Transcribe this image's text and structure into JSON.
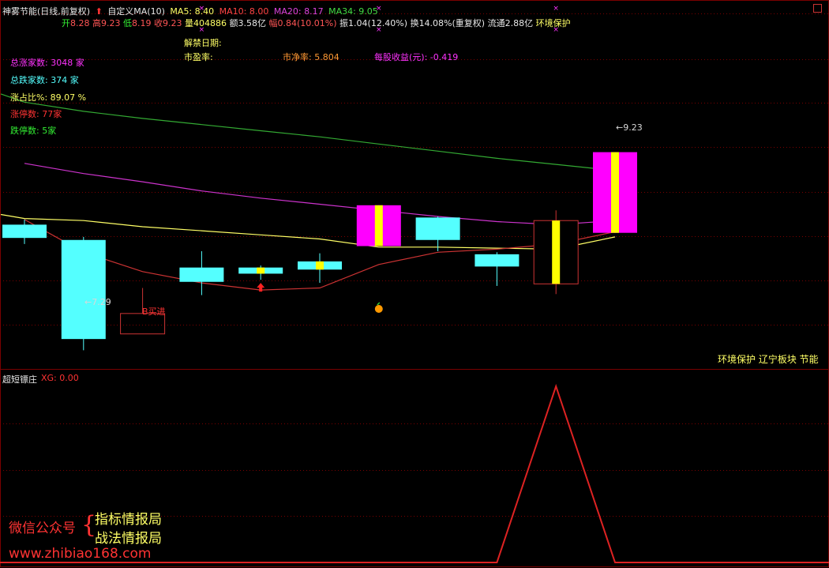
{
  "header": {
    "stock_title": "神雾节能(日线,前复权)",
    "indicator_name": "自定义MA(10)",
    "ma5": "MA5: 8.40",
    "ma10": "MA10: 8.00",
    "ma20": "MA20: 8.17",
    "ma34": "MA34: 9.05"
  },
  "quote_line": {
    "open_label": "开",
    "open": "8.28",
    "high_label": "高",
    "high": "9.23",
    "low_label": "低",
    "low": "8.19",
    "close_label": "收",
    "close": "9.23",
    "volume_label": "量",
    "volume": "404886",
    "amount_label": "额",
    "amount": "3.58亿",
    "change_label": "幅",
    "change": "0.84(10.01%)",
    "amplitude_label": "振",
    "amplitude": "1.04(12.40%)",
    "turnover_label": "换",
    "turnover": "14.08%(重复权)",
    "float_label": "流通",
    "float": "2.88亿",
    "concept": "环境保护"
  },
  "info": {
    "unlock_date_label": "解禁日期:",
    "pe_label": "市盈率:",
    "pb_text": "市净率: 5.804",
    "eps_text": "每股收益(元): -0.419"
  },
  "market_stats": {
    "up_count": "总涨家数: 3048 家",
    "down_count": "总跌家数: 374 家",
    "up_ratio": "涨占比%: 89.07 %",
    "limit_up": "涨停数: 77家",
    "limit_down": "跌停数: 5家"
  },
  "annotations": {
    "low_marker": "←7.29",
    "high_marker": "←9.23",
    "buy_signal": "B买进",
    "sector_tags": "环境保护 辽宁板块 节能"
  },
  "sub_panel": {
    "title": "超短镖庄",
    "xg_label": "XG: 0.00"
  },
  "watermark": {
    "wechat_label": "微信公众号",
    "brace": "{",
    "account1": "指标情报局",
    "account2": "战法情报局",
    "url": "www.zhibiao168.com"
  },
  "colors": {
    "up_fill": "#ff00ff",
    "up_body_inner": "#ffff00",
    "down_fill": "#54ffff",
    "up_hollow": "#cc3333",
    "ma5": "#ffff66",
    "ma10": "#cc3333",
    "ma20": "#cc33cc",
    "ma34": "#33aa33",
    "grid": "#7a0000",
    "xg_line": "#dd2222"
  },
  "chart_data": {
    "type": "candlestick",
    "price_range": [
      7.2,
      9.9
    ],
    "candles": [
      {
        "open": 8.52,
        "high": 8.57,
        "low": 8.33,
        "close": 8.39,
        "style": "down"
      },
      {
        "open": 8.37,
        "high": 8.4,
        "low": 7.29,
        "close": 7.4,
        "style": "down"
      },
      {
        "open": 7.65,
        "high": 7.9,
        "low": 7.45,
        "close": 7.45,
        "style": "buy_box"
      },
      {
        "open": 8.1,
        "high": 8.26,
        "low": 7.83,
        "close": 7.96,
        "style": "down"
      },
      {
        "open": 8.04,
        "high": 8.12,
        "low": 7.98,
        "close": 8.1,
        "style": "down_core"
      },
      {
        "open": 8.16,
        "high": 8.24,
        "low": 7.95,
        "close": 8.08,
        "style": "down_core"
      },
      {
        "open": 8.31,
        "high": 8.71,
        "low": 8.31,
        "close": 8.71,
        "style": "up"
      },
      {
        "open": 8.59,
        "high": 8.6,
        "low": 8.26,
        "close": 8.37,
        "style": "down"
      },
      {
        "open": 8.23,
        "high": 8.25,
        "low": 7.92,
        "close": 8.11,
        "style": "down"
      },
      {
        "open": 7.94,
        "high": 8.66,
        "low": 7.84,
        "close": 8.56,
        "style": "up_hollow"
      },
      {
        "open": 8.44,
        "high": 9.23,
        "low": 8.44,
        "close": 9.23,
        "style": "up"
      }
    ],
    "ma_lines": [
      {
        "name": "MA5",
        "values": [
          8.58,
          8.56,
          8.5,
          8.46,
          8.42,
          8.38,
          8.3,
          8.3,
          8.29,
          8.28,
          8.4
        ]
      },
      {
        "name": "MA10",
        "values": [
          8.57,
          8.25,
          8.06,
          7.95,
          7.88,
          7.9,
          8.13,
          8.25,
          8.28,
          8.33,
          8.45
        ]
      },
      {
        "name": "MA20",
        "values": [
          9.12,
          9.02,
          8.94,
          8.85,
          8.78,
          8.72,
          8.66,
          8.6,
          8.55,
          8.52,
          8.56
        ]
      },
      {
        "name": "MA34",
        "values": [
          9.72,
          9.63,
          9.56,
          9.5,
          9.44,
          9.38,
          9.31,
          9.24,
          9.17,
          9.11,
          9.05
        ]
      }
    ],
    "ma_lead_in": [
      {
        "name": "MA5",
        "value": 8.62
      },
      {
        "name": "MA34",
        "value": 9.8
      }
    ],
    "xg_values": [
      0,
      0,
      0,
      0,
      0,
      0,
      0,
      0,
      0,
      1,
      0
    ],
    "signal_markers": [
      {
        "candle": 4,
        "type": "up-arrow"
      },
      {
        "candle": 6,
        "type": "orange-dot"
      },
      {
        "candle": 3,
        "type": "x-mark"
      },
      {
        "candle": 6,
        "type": "x-mark"
      },
      {
        "candle": 9,
        "type": "x-mark"
      }
    ]
  }
}
